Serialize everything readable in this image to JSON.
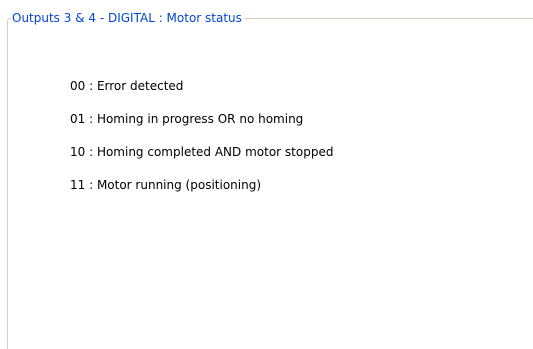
{
  "groupbox": {
    "title": "Outputs 3 & 4 - DIGITAL : Motor status",
    "title_color": "#0046d5",
    "border_color": "#d0d0bf"
  },
  "status_items": [
    {
      "code": "00",
      "label": "00 : Error detected"
    },
    {
      "code": "01",
      "label": "01 : Homing in progress OR no homing"
    },
    {
      "code": "10",
      "label": "10 : Homing completed AND motor stopped"
    },
    {
      "code": "11",
      "label": "11 : Motor running (positioning)"
    }
  ]
}
